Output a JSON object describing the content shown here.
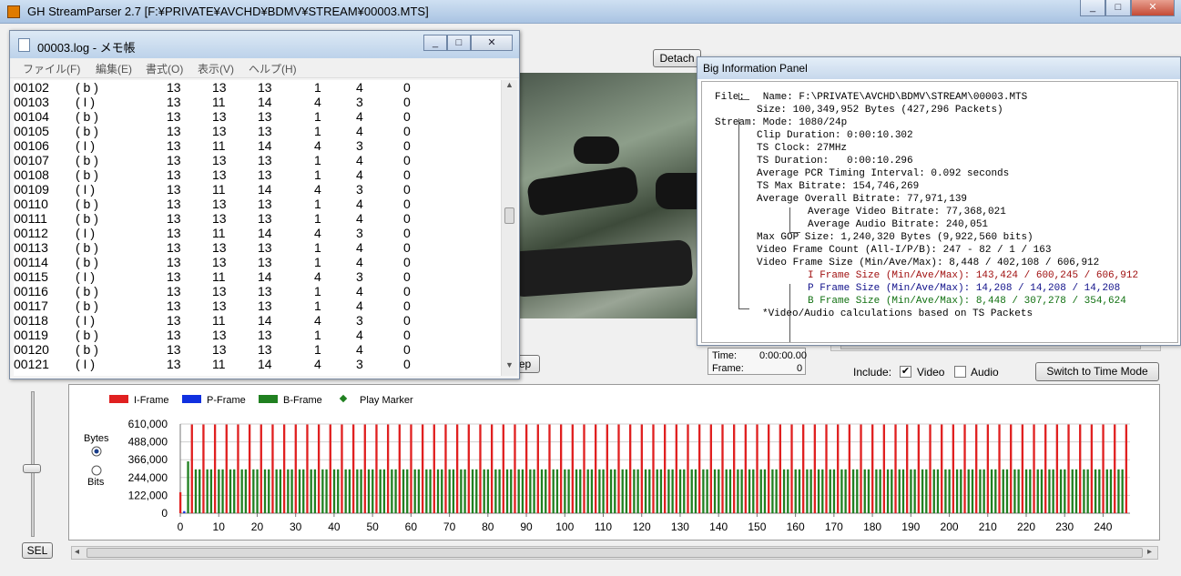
{
  "main": {
    "title": "GH StreamParser 2.7 [F:¥PRIVATE¥AVCHD¥BDMV¥STREAM¥00003.MTS]",
    "detach_label": "Detach",
    "time_label": "Time:",
    "time_value": "0:00:00.00",
    "frame_label": "Frame:",
    "frame_value": "0",
    "include_label": "Include:",
    "video_label": "Video",
    "audio_label": "Audio",
    "switch_label": "Switch to Time Mode",
    "sel_label": "SEL",
    "hidden_button_fragment": "ep"
  },
  "notepad": {
    "title": "00003.log - メモ帳",
    "menu": [
      "ファイル(F)",
      "編集(E)",
      "書式(O)",
      "表示(V)",
      "ヘルプ(H)"
    ],
    "rows": [
      [
        "00102",
        "( b )",
        "13",
        "13",
        "13",
        "1",
        "4",
        "0"
      ],
      [
        "00103",
        "( I )",
        "13",
        "11",
        "14",
        "4",
        "3",
        "0"
      ],
      [
        "00104",
        "( b )",
        "13",
        "13",
        "13",
        "1",
        "4",
        "0"
      ],
      [
        "00105",
        "( b )",
        "13",
        "13",
        "13",
        "1",
        "4",
        "0"
      ],
      [
        "00106",
        "( I )",
        "13",
        "11",
        "14",
        "4",
        "3",
        "0"
      ],
      [
        "00107",
        "( b )",
        "13",
        "13",
        "13",
        "1",
        "4",
        "0"
      ],
      [
        "00108",
        "( b )",
        "13",
        "13",
        "13",
        "1",
        "4",
        "0"
      ],
      [
        "00109",
        "( I )",
        "13",
        "11",
        "14",
        "4",
        "3",
        "0"
      ],
      [
        "00110",
        "( b )",
        "13",
        "13",
        "13",
        "1",
        "4",
        "0"
      ],
      [
        "00111",
        "( b )",
        "13",
        "13",
        "13",
        "1",
        "4",
        "0"
      ],
      [
        "00112",
        "( I )",
        "13",
        "11",
        "14",
        "4",
        "3",
        "0"
      ],
      [
        "00113",
        "( b )",
        "13",
        "13",
        "13",
        "1",
        "4",
        "0"
      ],
      [
        "00114",
        "( b )",
        "13",
        "13",
        "13",
        "1",
        "4",
        "0"
      ],
      [
        "00115",
        "( I )",
        "13",
        "11",
        "14",
        "4",
        "3",
        "0"
      ],
      [
        "00116",
        "( b )",
        "13",
        "13",
        "13",
        "1",
        "4",
        "0"
      ],
      [
        "00117",
        "( b )",
        "13",
        "13",
        "13",
        "1",
        "4",
        "0"
      ],
      [
        "00118",
        "( I )",
        "13",
        "11",
        "14",
        "4",
        "3",
        "0"
      ],
      [
        "00119",
        "( b )",
        "13",
        "13",
        "13",
        "1",
        "4",
        "0"
      ],
      [
        "00120",
        "( b )",
        "13",
        "13",
        "13",
        "1",
        "4",
        "0"
      ],
      [
        "00121",
        "( I )",
        "13",
        "11",
        "14",
        "4",
        "3",
        "0"
      ]
    ]
  },
  "info": {
    "title": "Big Information Panel",
    "lines": [
      {
        "text": "File:   Name: F:\\PRIVATE\\AVCHD\\BDMV\\STREAM\\00003.MTS",
        "color": "#000000"
      },
      {
        "text": "Size: 100,349,952 Bytes (427,296 Packets)",
        "color": "#000000"
      },
      {
        "text": "Stream: Mode: 1080/24p",
        "color": "#000000"
      },
      {
        "text": "Clip Duration: 0:00:10.302",
        "color": "#000000"
      },
      {
        "text": "TS Clock: 27MHz",
        "color": "#000000"
      },
      {
        "text": "TS Duration:   0:00:10.296",
        "color": "#000000"
      },
      {
        "text": "Average PCR Timing Interval: 0.092 seconds",
        "color": "#000000"
      },
      {
        "text": "TS Max Bitrate: 154,746,269",
        "color": "#000000"
      },
      {
        "text": "Average Overall Bitrate: 77,971,139",
        "color": "#000000"
      },
      {
        "text": "Average Video Bitrate: 77,368,021",
        "color": "#000000"
      },
      {
        "text": "Average Audio Bitrate: 240,051",
        "color": "#000000"
      },
      {
        "text": "Max GOP Size: 1,240,320 Bytes (9,922,560 bits)",
        "color": "#000000"
      },
      {
        "text": "Video Frame Count (All-I/P/B): 247 - 82 / 1 / 163",
        "color": "#000000"
      },
      {
        "text": "Video Frame Size (Min/Ave/Max): 8,448 / 402,108 / 606,912",
        "color": "#000000"
      },
      {
        "text": "I Frame Size (Min/Ave/Max): 143,424 / 600,245 / 606,912",
        "color": "#a01010"
      },
      {
        "text": "P Frame Size (Min/Ave/Max): 14,208 / 14,208 / 14,208",
        "color": "#10108a"
      },
      {
        "text": "B Frame Size (Min/Ave/Max): 8,448 / 307,278 / 354,624",
        "color": "#107010"
      },
      {
        "text": "*Video/Audio calculations based on TS Packets",
        "color": "#000000"
      }
    ]
  },
  "chart_data": {
    "type": "bar",
    "legend": [
      {
        "name": "I-Frame",
        "color": "#e02020"
      },
      {
        "name": "P-Frame",
        "color": "#1030e0"
      },
      {
        "name": "B-Frame",
        "color": "#208020"
      },
      {
        "name": "Play Marker",
        "color": "#208020"
      }
    ],
    "unit_options": [
      "Bytes",
      "Bits"
    ],
    "selected_unit": "Bytes",
    "ylim": [
      0,
      610000
    ],
    "yticks": [
      "610,000",
      "488,000",
      "366,000",
      "244,000",
      "122,000",
      "0"
    ],
    "ytick_values": [
      610000,
      488000,
      366000,
      244000,
      122000,
      0
    ],
    "xlim": [
      0,
      247
    ],
    "xticks": [
      0,
      10,
      20,
      30,
      40,
      50,
      60,
      70,
      80,
      90,
      100,
      110,
      120,
      130,
      140,
      150,
      160,
      170,
      180,
      190,
      200,
      210,
      220,
      230,
      240
    ],
    "frame_count": 247,
    "i_frame_value": 606912,
    "b_frame_value": 300000,
    "first_frame_value": 143424,
    "second_frame_value": 14208,
    "third_frame_value": 354624
  }
}
